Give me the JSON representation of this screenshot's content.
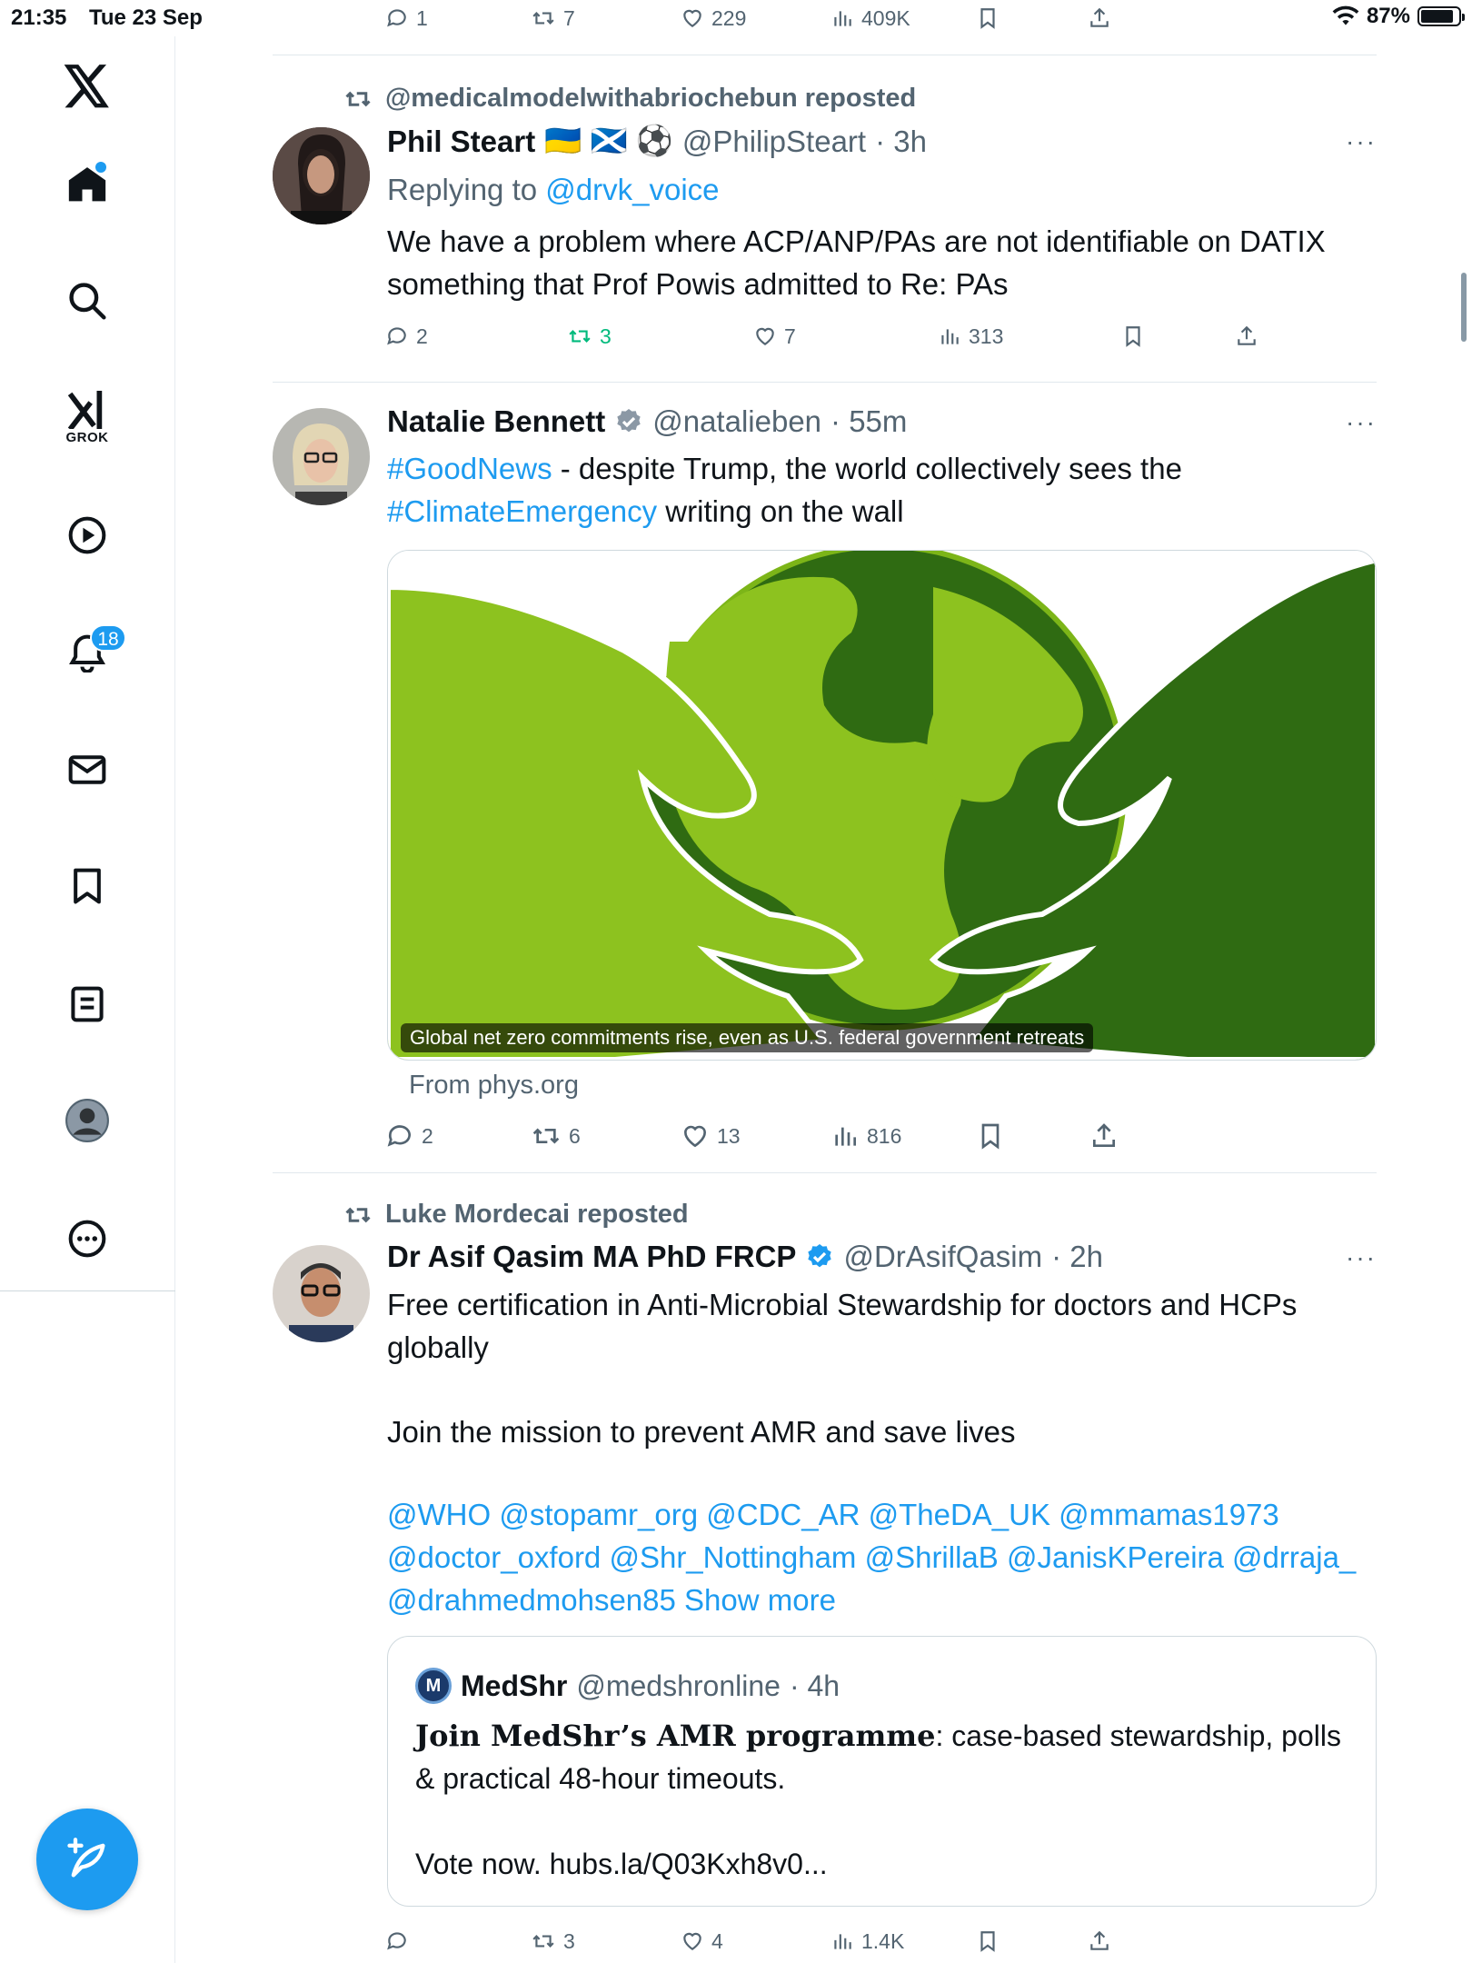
{
  "status_bar": {
    "time": "21:35",
    "date": "Tue 23 Sep",
    "battery": "87%",
    "battery_level": 0.87
  },
  "sidebar": {
    "grok_label": "GROK",
    "notifications_count": "18",
    "accent": "#1d9bf0"
  },
  "top_actions": {
    "replies": "1",
    "reposts": "7",
    "likes": "229",
    "views": "409K"
  },
  "post1": {
    "repost_by": "@medicalmodelwithabriochebun reposted",
    "name": "Phil Steart",
    "emoji": "🇺🇦 🏴󠁧󠁢󠁳󠁣󠁴󠁿 ⚽",
    "handle": "@PhilipSteart",
    "time": "· 3h",
    "replying_prefix": "Replying to",
    "replying_to": "@drvk_voice",
    "text": "We have a problem where ACP/ANP/PAs are not identifiable on DATIX something that Prof Powis admitted to Re: PAs",
    "replies": "2",
    "reposts": "3",
    "likes": "7",
    "views": "313"
  },
  "post2": {
    "name": "Natalie Bennett",
    "handle": "@natalieben",
    "time": "· 55m",
    "hashtag1": "#GoodNews",
    "text1": " - despite Trump, the world collectively sees the",
    "hashtag2": "#ClimateEmergency",
    "text2": " writing on the wall",
    "media_caption": "Global net zero commitments rise, even as U.S. federal government retreats",
    "source": "From phys.org",
    "replies": "2",
    "reposts": "6",
    "likes": "13",
    "views": "816"
  },
  "post3": {
    "repost_by": "Luke Mordecai reposted",
    "name": "Dr Asif Qasim MA PhD FRCP",
    "handle": "@DrAsifQasim",
    "time": "· 2h",
    "text1": "Free certification in Anti-Microbial Stewardship for doctors and HCPs globally",
    "text2": "Join the mission to prevent AMR and save lives",
    "mentions1": "@WHO @stopamr_org @CDC_AR @TheDA_UK @mmamas1973",
    "mentions2": "@doctor_oxford @Shr_Nottingham @ShrillaB @JanisKPereira @drraja_",
    "mentions3": "@drahmedmohsen85",
    "show_more": "Show more",
    "quote": {
      "logo": "M",
      "name": "MedShr",
      "handle": "@medshronline",
      "time": "· 4h",
      "bold": "Join MedShr’s AMR programme",
      "text": ": case-based stewardship, polls & practical 48-hour timeouts.",
      "vote": "Vote now. hubs.la/Q03Kxh8v0..."
    },
    "replies": "",
    "reposts": "3",
    "likes": "4",
    "views": "1.4K"
  }
}
